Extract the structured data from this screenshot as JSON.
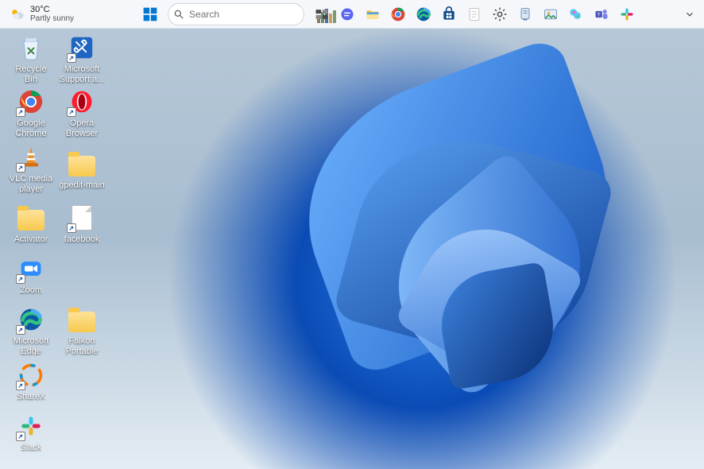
{
  "weather": {
    "temp": "30°C",
    "desc": "Partly sunny"
  },
  "search": {
    "placeholder": "Search"
  },
  "taskbar_icons": [
    {
      "name": "task-view",
      "title": "Task View"
    },
    {
      "name": "chat",
      "title": "Chat"
    },
    {
      "name": "file-explorer",
      "title": "File Explorer"
    },
    {
      "name": "google-chrome",
      "title": "Google Chrome"
    },
    {
      "name": "microsoft-edge",
      "title": "Microsoft Edge"
    },
    {
      "name": "microsoft-store",
      "title": "Microsoft Store"
    },
    {
      "name": "notepad",
      "title": "Notepad"
    },
    {
      "name": "settings",
      "title": "Settings"
    },
    {
      "name": "device-app",
      "title": "Device App"
    },
    {
      "name": "photos",
      "title": "Photos"
    },
    {
      "name": "copilot",
      "title": "Copilot"
    },
    {
      "name": "teams",
      "title": "Teams"
    },
    {
      "name": "slack",
      "title": "Slack"
    }
  ],
  "desktop": {
    "col0": [
      {
        "label": "Recycle Bin"
      },
      {
        "label": "Google Chrome"
      },
      {
        "label": "VLC media player"
      },
      {
        "label": "Activator"
      },
      {
        "label": "Zoom"
      },
      {
        "label": "Microsoft Edge"
      },
      {
        "label": "ShareX"
      },
      {
        "label": "Slack"
      }
    ],
    "col1": [
      {
        "label": "Microsoft Support a..."
      },
      {
        "label": "Opera Browser"
      },
      {
        "label": "gpedit-main"
      },
      {
        "label": "facebook"
      },
      {
        "label": "Falkon Portable"
      }
    ]
  }
}
